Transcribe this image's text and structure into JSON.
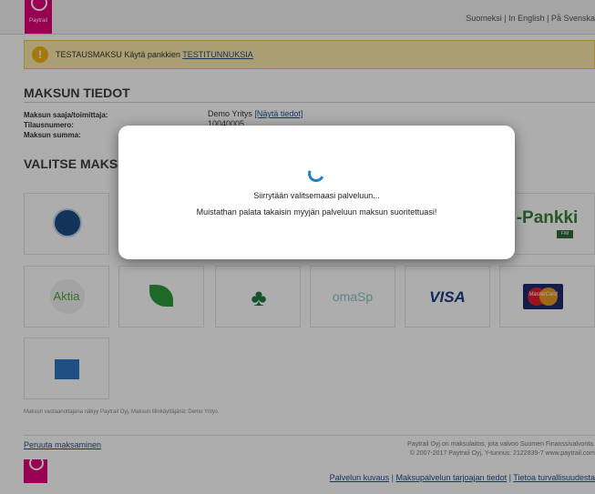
{
  "header": {
    "logo_text": "Paytrail",
    "languages": "Suomeksi | In English | På Svenska"
  },
  "notice": {
    "icon": "warning-icon",
    "text": "TESTAUSMAKSU Käytä pankkien ",
    "link": "TESTITUNNUKSIA"
  },
  "payment_info": {
    "heading": "MAKSUN TIEDOT",
    "recipient_label": "Maksun saaja/toimittaja:",
    "recipient_value": "Demo Yritys ",
    "recipient_link": "[Näytä tiedot]",
    "order_label": "Tilausnumero:",
    "order_value": "10040005",
    "amount_label": "Maksun summa:"
  },
  "choose_heading": "VALITSE MAKSUTAPA",
  "methods": {
    "nordea": "Nordea",
    "op": "-Pankki",
    "op_badge": "FIM",
    "aktia": "Aktia",
    "savings_bank": "Säästöpankki",
    "pop": "POP Pankki",
    "omasp": "omaSp",
    "visa": "VISA",
    "mastercard": "MasterCard",
    "amex": "AMERICAN EXPRESS"
  },
  "footnote": "Maksun vastaanottajana näkyy Paytrail Oyj. Maksun tilinkäyttäjänä: Demo Yritys.",
  "cancel_link": "Peruuta maksaminen",
  "company_line1": "Paytrail Oyj on maksulaitos, jota valvoo Suomen Finanssivalvonta.",
  "company_line2": "© 2007-2017 Paytrail Oyj, Y-tunnus: 2122839-7 www.paytrail.com",
  "footer_links": {
    "service": "Palvelun kuvaus",
    "terms": "Maksupalvelun tarjoajan tiedot",
    "security": "Tietoa turvallisuudesta",
    "sep": " | "
  },
  "modal": {
    "line1": "Siirrytään valitsemaasi palveluun...",
    "line2": "Muistathan palata takaisin myyjän palveluun maksun suoritettuasi!"
  },
  "colors": {
    "brand": "#e2007a",
    "notice_bg": "#fde9a8",
    "link": "#1f4e8c",
    "spinner": "#1c82c8"
  }
}
